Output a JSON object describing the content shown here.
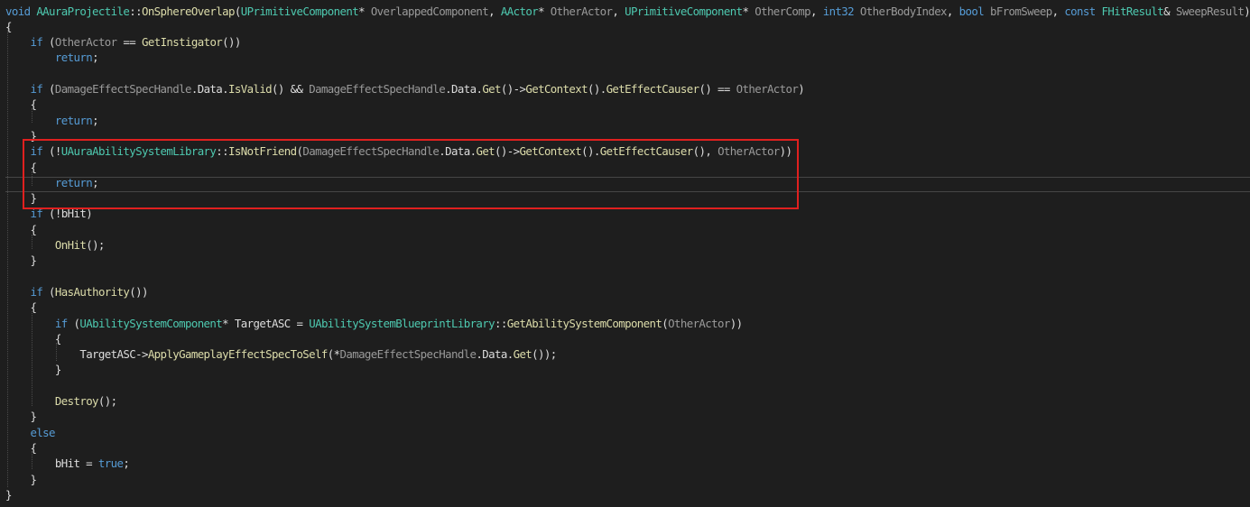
{
  "code_editor": {
    "language": "C++",
    "highlighted_block": "lines 10-13",
    "colors": {
      "background": "#1e1e1e",
      "keyword": "#569cd6",
      "type": "#4ec9b0",
      "function": "#dcdcaa",
      "parameter": "#9a9a9a",
      "plain": "#dcdcdc",
      "highlight_box": "#e0201f"
    },
    "lines": [
      [
        [
          "kw",
          "void "
        ],
        [
          "ty",
          "AAuraProjectile"
        ],
        [
          "pl",
          "::"
        ],
        [
          "fn",
          "OnSphereOverlap"
        ],
        [
          "pl",
          "("
        ],
        [
          "ty",
          "UPrimitiveComponent"
        ],
        [
          "pl",
          "* "
        ],
        [
          "pr",
          "OverlappedComponent"
        ],
        [
          "pl",
          ", "
        ],
        [
          "ty",
          "AActor"
        ],
        [
          "pl",
          "* "
        ],
        [
          "pr",
          "OtherActor"
        ],
        [
          "pl",
          ", "
        ],
        [
          "ty",
          "UPrimitiveComponent"
        ],
        [
          "pl",
          "* "
        ],
        [
          "pr",
          "OtherComp"
        ],
        [
          "pl",
          ", "
        ],
        [
          "kw",
          "int32 "
        ],
        [
          "pr",
          "OtherBodyIndex"
        ],
        [
          "pl",
          ", "
        ],
        [
          "kw",
          "bool "
        ],
        [
          "pr",
          "bFromSweep"
        ],
        [
          "pl",
          ", "
        ],
        [
          "kw",
          "const "
        ],
        [
          "ty",
          "FHitResult"
        ],
        [
          "pl",
          "& "
        ],
        [
          "pr",
          "SweepResult"
        ],
        [
          "pl",
          ")"
        ]
      ],
      [
        [
          "pl",
          "{"
        ]
      ],
      [
        [
          "pl",
          "    "
        ],
        [
          "kw",
          "if "
        ],
        [
          "pl",
          "("
        ],
        [
          "pr",
          "OtherActor"
        ],
        [
          "pl",
          " == "
        ],
        [
          "fn",
          "GetInstigator"
        ],
        [
          "pl",
          "())"
        ]
      ],
      [
        [
          "pl",
          "        "
        ],
        [
          "kw",
          "return"
        ],
        [
          "pl",
          ";"
        ]
      ],
      [],
      [
        [
          "pl",
          "    "
        ],
        [
          "kw",
          "if "
        ],
        [
          "pl",
          "("
        ],
        [
          "pr",
          "DamageEffectSpecHandle"
        ],
        [
          "pl",
          ".Data."
        ],
        [
          "fn",
          "IsValid"
        ],
        [
          "pl",
          "() && "
        ],
        [
          "pr",
          "DamageEffectSpecHandle"
        ],
        [
          "pl",
          ".Data."
        ],
        [
          "fn",
          "Get"
        ],
        [
          "pl",
          "()->"
        ],
        [
          "fn",
          "GetContext"
        ],
        [
          "pl",
          "()."
        ],
        [
          "fn",
          "GetEffectCauser"
        ],
        [
          "pl",
          "() == "
        ],
        [
          "pr",
          "OtherActor"
        ],
        [
          "pl",
          ")"
        ]
      ],
      [
        [
          "pl",
          "    {"
        ]
      ],
      [
        [
          "pl",
          "        "
        ],
        [
          "kw",
          "return"
        ],
        [
          "pl",
          ";"
        ]
      ],
      [
        [
          "pl",
          "    }"
        ]
      ],
      [
        [
          "pl",
          "    "
        ],
        [
          "kw",
          "if "
        ],
        [
          "pl",
          "(!"
        ],
        [
          "ty",
          "UAuraAbilitySystemLibrary"
        ],
        [
          "pl",
          "::"
        ],
        [
          "fn",
          "IsNotFriend"
        ],
        [
          "pl",
          "("
        ],
        [
          "pr",
          "DamageEffectSpecHandle"
        ],
        [
          "pl",
          ".Data."
        ],
        [
          "fn",
          "Get"
        ],
        [
          "pl",
          "()->"
        ],
        [
          "fn",
          "GetContext"
        ],
        [
          "pl",
          "()."
        ],
        [
          "fn",
          "GetEffectCauser"
        ],
        [
          "pl",
          "(), "
        ],
        [
          "pr",
          "OtherActor"
        ],
        [
          "pl",
          "))"
        ]
      ],
      [
        [
          "pl",
          "    {"
        ]
      ],
      [
        [
          "pl",
          "        "
        ],
        [
          "kw",
          "return"
        ],
        [
          "pl",
          ";"
        ]
      ],
      [
        [
          "pl",
          "    }"
        ]
      ],
      [
        [
          "pl",
          "    "
        ],
        [
          "kw",
          "if "
        ],
        [
          "pl",
          "(!bHit)"
        ]
      ],
      [
        [
          "pl",
          "    {"
        ]
      ],
      [
        [
          "pl",
          "        "
        ],
        [
          "fn",
          "OnHit"
        ],
        [
          "pl",
          "();"
        ]
      ],
      [
        [
          "pl",
          "    }"
        ]
      ],
      [],
      [
        [
          "pl",
          "    "
        ],
        [
          "kw",
          "if "
        ],
        [
          "pl",
          "("
        ],
        [
          "fn",
          "HasAuthority"
        ],
        [
          "pl",
          "())"
        ]
      ],
      [
        [
          "pl",
          "    {"
        ]
      ],
      [
        [
          "pl",
          "        "
        ],
        [
          "kw",
          "if "
        ],
        [
          "pl",
          "("
        ],
        [
          "ty",
          "UAbilitySystemComponent"
        ],
        [
          "pl",
          "* "
        ],
        [
          "tx",
          "TargetASC"
        ],
        [
          "pl",
          " = "
        ],
        [
          "ty",
          "UAbilitySystemBlueprintLibrary"
        ],
        [
          "pl",
          "::"
        ],
        [
          "fn",
          "GetAbilitySystemComponent"
        ],
        [
          "pl",
          "("
        ],
        [
          "pr",
          "OtherActor"
        ],
        [
          "pl",
          "))"
        ]
      ],
      [
        [
          "pl",
          "        {"
        ]
      ],
      [
        [
          "pl",
          "            "
        ],
        [
          "tx",
          "TargetASC"
        ],
        [
          "pl",
          "->"
        ],
        [
          "fn",
          "ApplyGameplayEffectSpecToSelf"
        ],
        [
          "pl",
          "(*"
        ],
        [
          "pr",
          "DamageEffectSpecHandle"
        ],
        [
          "pl",
          ".Data."
        ],
        [
          "fn",
          "Get"
        ],
        [
          "pl",
          "());"
        ]
      ],
      [
        [
          "pl",
          "        }"
        ]
      ],
      [],
      [
        [
          "pl",
          "        "
        ],
        [
          "fn",
          "Destroy"
        ],
        [
          "pl",
          "();"
        ]
      ],
      [
        [
          "pl",
          "    }"
        ]
      ],
      [
        [
          "pl",
          "    "
        ],
        [
          "kw",
          "else"
        ]
      ],
      [
        [
          "pl",
          "    {"
        ]
      ],
      [
        [
          "pl",
          "        bHit = "
        ],
        [
          "kw",
          "true"
        ],
        [
          "pl",
          ";"
        ]
      ],
      [
        [
          "pl",
          "    }"
        ]
      ],
      [
        [
          "pl",
          "}"
        ]
      ]
    ]
  }
}
